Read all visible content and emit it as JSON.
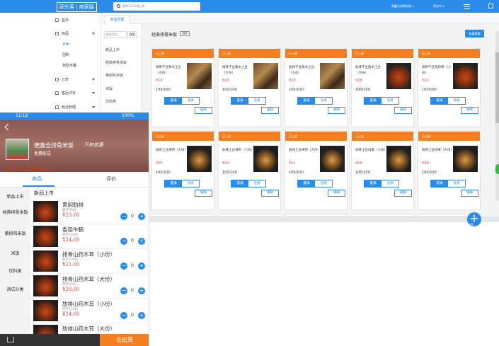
{
  "header": {
    "brand": "回头客 | 商家版",
    "search_placeholder": "搜索121价格订单",
    "store": "德鑫全排骨米饭 ▾",
    "account": "营业中 ▾"
  },
  "sidebar": {
    "items": [
      {
        "label": "首页"
      },
      {
        "label": "商品"
      },
      {
        "label": "订单"
      },
      {
        "label": "售后评论"
      },
      {
        "label": "粉丝管理"
      }
    ],
    "sub_items": [
      {
        "label": "外卖"
      },
      {
        "label": "团购"
      },
      {
        "label": "自助点餐"
      }
    ]
  },
  "tab": {
    "label": "商品管理"
  },
  "category_panel": {
    "search_placeholder": "搜索商品",
    "search_button": "搜索",
    "categories": [
      {
        "label": "新品上市"
      },
      {
        "label": "经典排骨米饭"
      },
      {
        "label": "黄焖鸡米饭"
      },
      {
        "label": "米饭"
      },
      {
        "label": "饮料类"
      }
    ]
  },
  "main": {
    "title": "经典排骨米饭",
    "edit_label": "编辑",
    "batch_button": "批量管理",
    "fab_label": "添加"
  },
  "products": [
    {
      "status": "已上架",
      "name": "排骨干豆角木土豆（小份）",
      "price": "¥20",
      "stock": "100/100",
      "on_label": "置满",
      "off_label": "沽清",
      "edit_label": "编辑"
    },
    {
      "status": "已上架",
      "name": "排骨干豆角木土豆（大份）",
      "price": "¥25",
      "stock": "100/100",
      "on_label": "置满",
      "off_label": "沽清",
      "edit_label": "编辑"
    },
    {
      "status": "已上架",
      "name": "肋排干豆角木土豆（小份）",
      "price": "¥23",
      "stock": "100/100",
      "on_label": "置满",
      "off_label": "沽清",
      "edit_label": "编辑"
    },
    {
      "status": "已上架",
      "name": "肋排干豆角木土豆（大份）",
      "price": "¥28",
      "stock": "100/100",
      "on_label": "置满",
      "off_label": "沽清",
      "edit_label": "编辑"
    },
    {
      "status": "已上架",
      "name": "排骨干豆角白果（小份）",
      "price": "¥20",
      "stock": "100/100",
      "on_label": "置满",
      "off_label": "沽清",
      "edit_label": "编辑"
    },
    {
      "status": "已上架",
      "name": "排骨土豆海带（大份）",
      "price": "¥25",
      "stock": "100/100",
      "on_label": "置满",
      "off_label": "沽清",
      "edit_label": "编辑"
    },
    {
      "status": "已上架",
      "name": "肋排土豆海带（小份）",
      "price": "¥23",
      "stock": "100/100",
      "on_label": "置满",
      "off_label": "沽清",
      "edit_label": "编辑"
    },
    {
      "status": "已上架",
      "name": "肋排土豆海带（大份）",
      "price": "¥31",
      "stock": "100/100",
      "on_label": "置满",
      "off_label": "沽清",
      "edit_label": "编辑"
    },
    {
      "status": "已上架",
      "name": "排骨土豆白果（小份）",
      "price": "¥19",
      "stock": "100/100",
      "on_label": "置满",
      "off_label": "沽清",
      "edit_label": "编辑"
    },
    {
      "status": "已上架",
      "name": "排骨土豆白果（大份）",
      "price": "¥24",
      "stock": "100/100",
      "on_label": "置满",
      "off_label": "沽清",
      "edit_label": "编辑"
    }
  ],
  "mobile": {
    "time": "11:19",
    "battery": "100%",
    "shop_name": "德鑫全排骨米饭",
    "shop_sub": "下单优惠",
    "delivery": "免费配送",
    "marquee": "欢迎进入会员回购平台",
    "tab_goods": "商品",
    "tab_reviews": "评价",
    "categories": [
      {
        "label": "新品上市"
      },
      {
        "label": "经典排骨米饭"
      },
      {
        "label": "黄焖鸡米饭"
      },
      {
        "label": "米饭"
      },
      {
        "label": "饮料类"
      },
      {
        "label": "测试分类"
      }
    ],
    "section": "新品上市",
    "items": [
      {
        "title": "黄焖肋排",
        "stock": "库存99份",
        "price": "¥23.00",
        "qty": "0"
      },
      {
        "title": "香菇牛腩",
        "stock": "库存100份",
        "price": "¥24.00",
        "qty": "0"
      },
      {
        "title": "排骨山药木耳（小份）",
        "stock": "库存100份",
        "price": "¥21.00",
        "qty": "0"
      },
      {
        "title": "排骨山药木耳（大份）",
        "stock": "库存99份",
        "price": "¥26.00",
        "qty": "0"
      },
      {
        "title": "肋排山药木耳（小份）",
        "stock": "库存100份",
        "price": "¥24.00",
        "qty": "0"
      },
      {
        "title": "肋排山药木耳（大份）",
        "stock": "",
        "price": "",
        "qty": ""
      }
    ],
    "checkout": "去结算"
  },
  "colors": {
    "primary": "#2a8ce8",
    "orange": "#f57e1e",
    "price": "#f04040"
  }
}
